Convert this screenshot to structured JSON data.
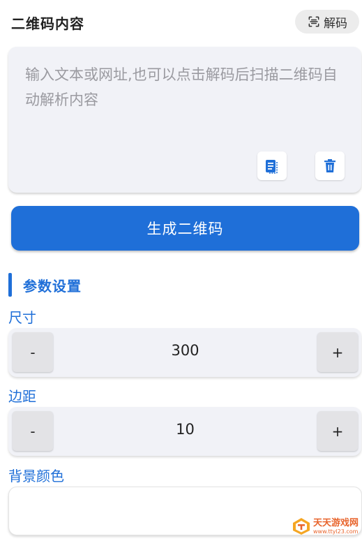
{
  "header": {
    "title": "二维码内容",
    "decode_label": "解码"
  },
  "content_input": {
    "value": "",
    "placeholder": "输入文本或网址,也可以点击解码后扫描二维码自动解析内容"
  },
  "generate_label": "生成二维码",
  "params": {
    "section_title": "参数设置",
    "size": {
      "label": "尺寸",
      "value": "300",
      "minus": "-",
      "plus": "+"
    },
    "margin": {
      "label": "边距",
      "value": "10",
      "minus": "-",
      "plus": "+"
    },
    "background": {
      "label": "背景颜色",
      "value": ""
    }
  },
  "watermark": {
    "main": "天天游戏网",
    "sub": "www.ttyl23.com"
  },
  "colors": {
    "accent": "#1f6fd8",
    "card_bg": "#f1f2f7",
    "watermark": "#e8642c"
  }
}
